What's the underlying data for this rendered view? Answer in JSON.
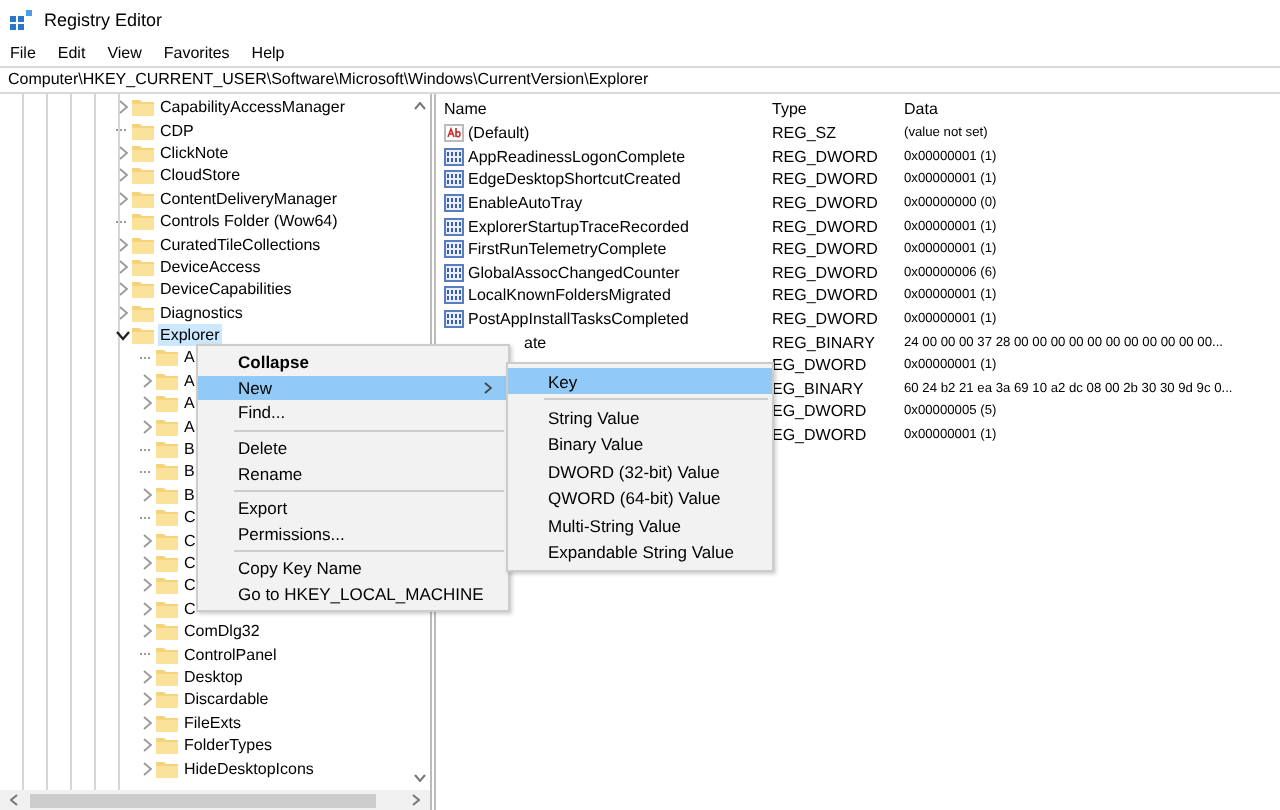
{
  "window": {
    "title": "Registry Editor"
  },
  "menu_bar": [
    "File",
    "Edit",
    "View",
    "Favorites",
    "Help"
  ],
  "address": "Computer\\HKEY_CURRENT_USER\\Software\\Microsoft\\Windows\\CurrentVersion\\Explorer",
  "tree": [
    {
      "label": "CapabilityAccessManager",
      "expandable": true,
      "expanded": false,
      "selected": false
    },
    {
      "label": "CDP",
      "expandable": false,
      "selected": false
    },
    {
      "label": "ClickNote",
      "expandable": true,
      "expanded": false,
      "selected": false
    },
    {
      "label": "CloudStore",
      "expandable": true,
      "expanded": false,
      "selected": false
    },
    {
      "label": "ContentDeliveryManager",
      "expandable": true,
      "expanded": false,
      "selected": false
    },
    {
      "label": "Controls Folder (Wow64)",
      "expandable": false,
      "selected": false
    },
    {
      "label": "CuratedTileCollections",
      "expandable": true,
      "expanded": false,
      "selected": false
    },
    {
      "label": "DeviceAccess",
      "expandable": true,
      "expanded": false,
      "selected": false
    },
    {
      "label": "DeviceCapabilities",
      "expandable": true,
      "expanded": false,
      "selected": false
    },
    {
      "label": "Diagnostics",
      "expandable": true,
      "expanded": false,
      "selected": false
    },
    {
      "label": "Explorer",
      "expandable": true,
      "expanded": true,
      "selected": true,
      "children": [
        {
          "label": "A",
          "expandable": false,
          "selected": false
        },
        {
          "label": "A",
          "expandable": true,
          "expanded": false,
          "selected": false
        },
        {
          "label": "A",
          "expandable": true,
          "expanded": false,
          "selected": false
        },
        {
          "label": "A",
          "expandable": true,
          "expanded": false,
          "selected": false
        },
        {
          "label": "B",
          "expandable": false,
          "selected": false
        },
        {
          "label": "B",
          "expandable": false,
          "selected": false
        },
        {
          "label": "B",
          "expandable": true,
          "expanded": false,
          "selected": false
        },
        {
          "label": "C",
          "expandable": false,
          "selected": false
        },
        {
          "label": "C",
          "expandable": true,
          "expanded": false,
          "selected": false
        },
        {
          "label": "C",
          "expandable": true,
          "expanded": false,
          "selected": false
        },
        {
          "label": "C",
          "expandable": true,
          "expanded": false,
          "selected": false
        },
        {
          "label": "C",
          "expandable": true,
          "expanded": false,
          "selected": false
        },
        {
          "label": "ComDlg32",
          "expandable": true,
          "expanded": false,
          "selected": false
        },
        {
          "label": "ControlPanel",
          "expandable": false,
          "selected": false
        },
        {
          "label": "Desktop",
          "expandable": true,
          "expanded": false,
          "selected": false
        },
        {
          "label": "Discardable",
          "expandable": true,
          "expanded": false,
          "selected": false
        },
        {
          "label": "FileExts",
          "expandable": true,
          "expanded": false,
          "selected": false
        },
        {
          "label": "FolderTypes",
          "expandable": true,
          "expanded": false,
          "selected": false
        },
        {
          "label": "HideDesktopIcons",
          "expandable": true,
          "expanded": false,
          "selected": false
        }
      ]
    }
  ],
  "values": {
    "columns": [
      "Name",
      "Type",
      "Data"
    ],
    "rows": [
      {
        "kind": "string",
        "name": "(Default)",
        "type": "REG_SZ",
        "data": "(value not set)"
      },
      {
        "kind": "dword",
        "name": "AppReadinessLogonComplete",
        "type": "REG_DWORD",
        "data": "0x00000001 (1)"
      },
      {
        "kind": "dword",
        "name": "EdgeDesktopShortcutCreated",
        "type": "REG_DWORD",
        "data": "0x00000001 (1)"
      },
      {
        "kind": "dword",
        "name": "EnableAutoTray",
        "type": "REG_DWORD",
        "data": "0x00000000 (0)"
      },
      {
        "kind": "dword",
        "name": "ExplorerStartupTraceRecorded",
        "type": "REG_DWORD",
        "data": "0x00000001 (1)"
      },
      {
        "kind": "dword",
        "name": "FirstRunTelemetryComplete",
        "type": "REG_DWORD",
        "data": "0x00000001 (1)"
      },
      {
        "kind": "dword",
        "name": "GlobalAssocChangedCounter",
        "type": "REG_DWORD",
        "data": "0x00000006 (6)"
      },
      {
        "kind": "dword",
        "name": "LocalKnownFoldersMigrated",
        "type": "REG_DWORD",
        "data": "0x00000001 (1)"
      },
      {
        "kind": "dword",
        "name": "PostAppInstallTasksCompleted",
        "type": "REG_DWORD",
        "data": "0x00000001 (1)"
      },
      {
        "kind": "covered",
        "name": "ate",
        "type": "REG_BINARY",
        "data": "24 00 00 00 37 28 00 00 00 00 00 00 00 00 00 00 00..."
      },
      {
        "kind": "covered",
        "type": "EG_DWORD",
        "data": "0x00000001 (1)"
      },
      {
        "kind": "covered",
        "type": "EG_BINARY",
        "data": "60 24 b2 21 ea 3a 69 10 a2 dc 08 00 2b 30 30 9d 9c 0..."
      },
      {
        "kind": "covered",
        "type": "EG_DWORD",
        "data": "0x00000005 (5)"
      },
      {
        "kind": "covered",
        "type": "EG_DWORD",
        "data": "0x00000001 (1)"
      }
    ]
  },
  "context_menu": [
    {
      "kind": "item",
      "label": "Collapse",
      "default": true,
      "selected": false,
      "submenu": false
    },
    {
      "kind": "item",
      "label": "New",
      "default": false,
      "selected": true,
      "submenu": true
    },
    {
      "kind": "item",
      "label": "Find...",
      "default": false,
      "selected": false,
      "submenu": false
    },
    {
      "kind": "separator"
    },
    {
      "kind": "item",
      "label": "Delete",
      "default": false,
      "selected": false,
      "submenu": false
    },
    {
      "kind": "item",
      "label": "Rename",
      "default": false,
      "selected": false,
      "submenu": false
    },
    {
      "kind": "separator"
    },
    {
      "kind": "item",
      "label": "Export",
      "default": false,
      "selected": false,
      "submenu": false
    },
    {
      "kind": "item",
      "label": "Permissions...",
      "default": false,
      "selected": false,
      "submenu": false
    },
    {
      "kind": "separator"
    },
    {
      "kind": "item",
      "label": "Copy Key Name",
      "default": false,
      "selected": false,
      "submenu": false
    },
    {
      "kind": "item",
      "label": "Go to HKEY_LOCAL_MACHINE",
      "default": false,
      "selected": false,
      "submenu": false
    }
  ],
  "submenu": [
    {
      "kind": "item",
      "label": "Key",
      "selected": true
    },
    {
      "kind": "separator"
    },
    {
      "kind": "item",
      "label": "String Value",
      "selected": false
    },
    {
      "kind": "item",
      "label": "Binary Value",
      "selected": false
    },
    {
      "kind": "item",
      "label": "DWORD (32-bit) Value",
      "selected": false
    },
    {
      "kind": "item",
      "label": "QWORD (64-bit) Value",
      "selected": false
    },
    {
      "kind": "item",
      "label": "Multi-String Value",
      "selected": false
    },
    {
      "kind": "item",
      "label": "Expandable String Value",
      "selected": false
    }
  ]
}
